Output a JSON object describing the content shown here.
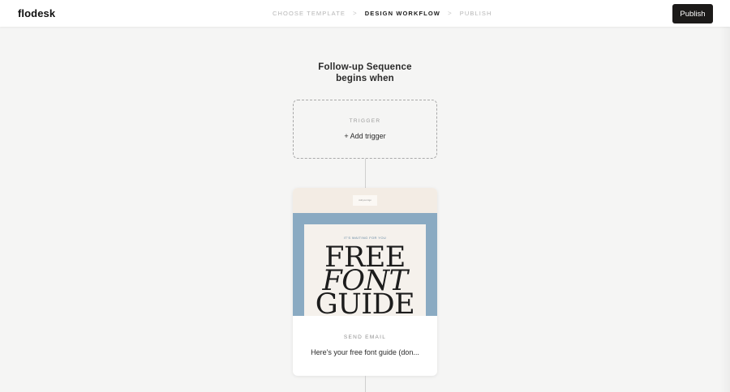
{
  "app": {
    "logo": "flodesk"
  },
  "header": {
    "steps": [
      {
        "label": "CHOOSE TEMPLATE",
        "state": "inactive"
      },
      {
        "label": "DESIGN WORKFLOW",
        "state": "active"
      },
      {
        "label": "PUBLISH",
        "state": "inactive"
      }
    ],
    "separator": ">",
    "publish_label": "Publish"
  },
  "workflow": {
    "title_line1": "Follow-up Sequence",
    "title_line2": "begins when",
    "trigger": {
      "label": "TRIGGER",
      "add_label": "+ Add trigger"
    },
    "email_card": {
      "preview": {
        "logo_text": "Add your logo",
        "kicker": "IT'S WAITING FOR YOU",
        "line1": "FREE",
        "line2": "FONT",
        "line3": "GUIDE"
      },
      "label": "SEND EMAIL",
      "subject": "Here's your free font guide (don..."
    }
  },
  "colors": {
    "accent": "#1c1a19",
    "background": "#f5f5f4",
    "hero_blue": "#8aaac2",
    "header_beige": "#f3ece4"
  }
}
